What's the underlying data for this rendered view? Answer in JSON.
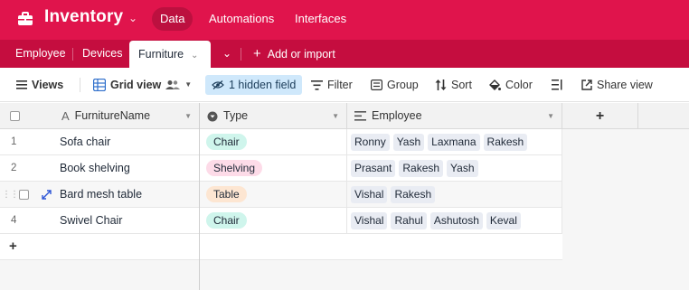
{
  "app": {
    "title": "Inventory",
    "nav": [
      {
        "label": "Data",
        "active": true
      },
      {
        "label": "Automations",
        "active": false
      },
      {
        "label": "Interfaces",
        "active": false
      }
    ],
    "brand_color": "#e0144c"
  },
  "tabs": {
    "items": [
      {
        "label": "Employee",
        "active": false
      },
      {
        "label": "Devices",
        "active": false
      },
      {
        "label": "Furniture",
        "active": true
      }
    ],
    "add_label": "Add or import"
  },
  "toolbar": {
    "views": "Views",
    "grid_view": "Grid view",
    "hidden_field": "1 hidden field",
    "filter": "Filter",
    "group": "Group",
    "sort": "Sort",
    "color": "Color",
    "share": "Share view"
  },
  "grid": {
    "columns": [
      {
        "label": "FurnitureName",
        "icon": "text-field-icon"
      },
      {
        "label": "Type",
        "icon": "single-select-icon"
      },
      {
        "label": "Employee",
        "icon": "linked-record-icon"
      }
    ],
    "add_column": "+",
    "add_row": "+",
    "rows": [
      {
        "num": "1",
        "name": "Sofa chair",
        "type": "Chair",
        "type_color": "#cff5ec",
        "employees": [
          "Ronny",
          "Yash",
          "Laxmana",
          "Rakesh"
        ]
      },
      {
        "num": "2",
        "name": "Book shelving",
        "type": "Shelving",
        "type_color": "#fddbe8",
        "employees": [
          "Prasant",
          "Rakesh",
          "Yash"
        ]
      },
      {
        "num": "",
        "name": "Bard mesh table",
        "type": "Table",
        "type_color": "#fde6d2",
        "employees": [
          "Vishal",
          "Rakesh"
        ]
      },
      {
        "num": "4",
        "name": "Swivel Chair",
        "type": "Chair",
        "type_color": "#cff5ec",
        "employees": [
          "Vishal",
          "Rahul",
          "Ashutosh",
          "Keval"
        ]
      }
    ]
  }
}
